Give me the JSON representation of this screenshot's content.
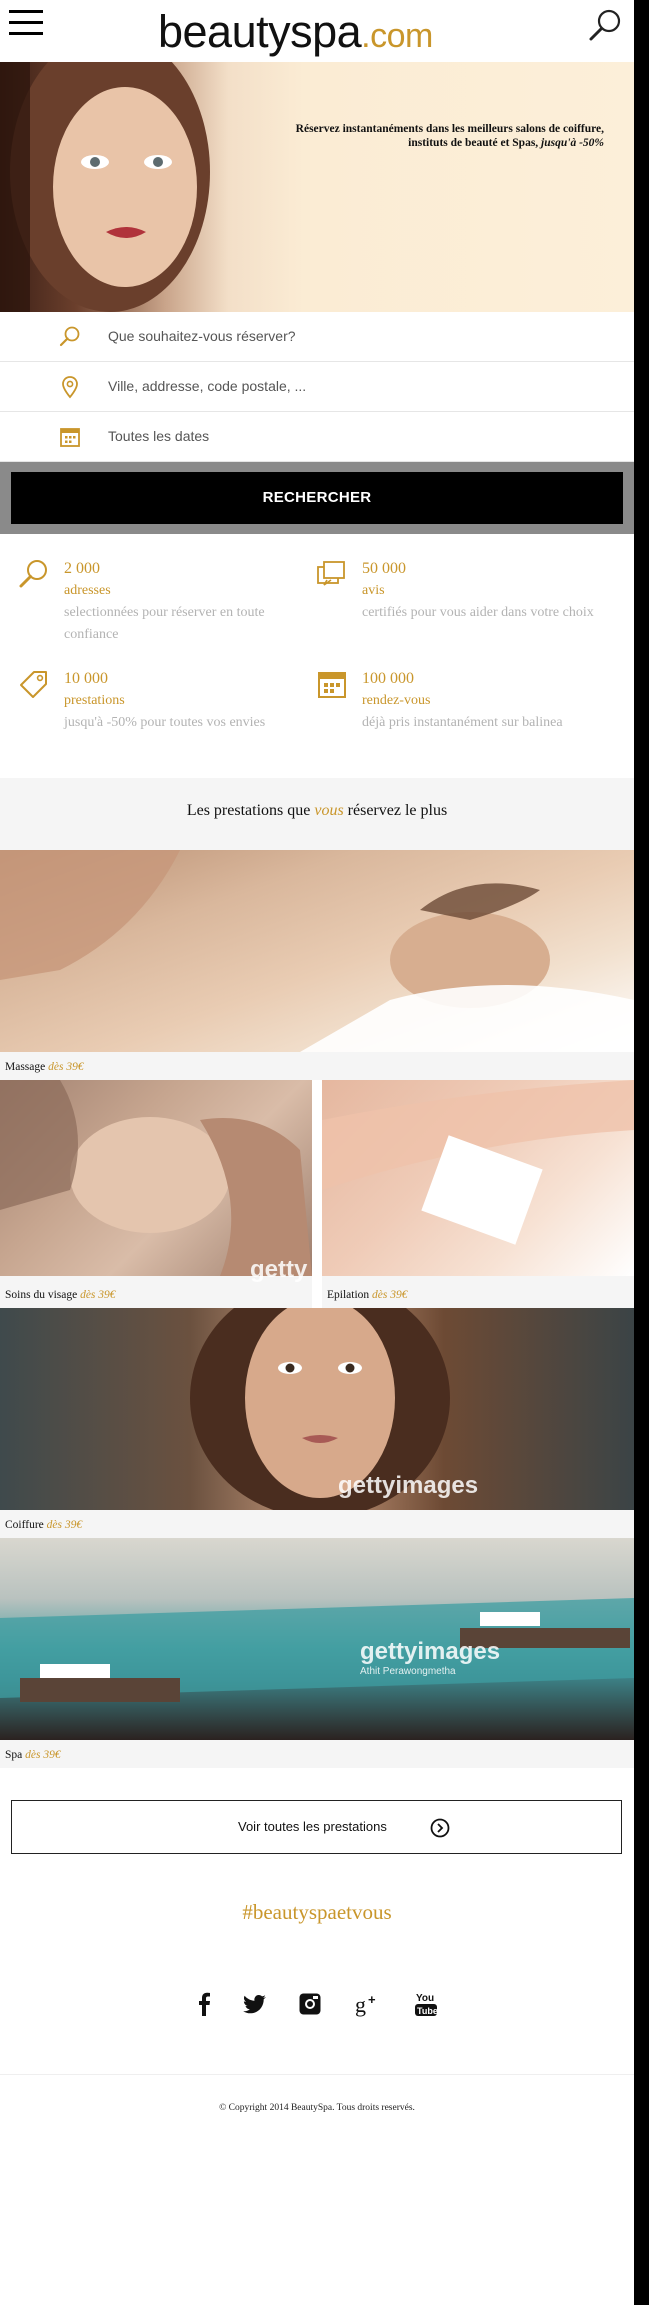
{
  "header": {
    "logo_main": "beautyspa",
    "logo_domain": ".com"
  },
  "hero": {
    "line1": "Réservez instantanéments dans les meilleurs salons de coiffure,",
    "line2_prefix": "instituts de beauté et Spas,",
    "line2_em": "jusqu'à -50%"
  },
  "search": {
    "what_placeholder": "Que souhaitez-vous réserver?",
    "where_placeholder": "Ville, addresse, code postale, ...",
    "when_placeholder": "Toutes les dates",
    "button_label": "RECHERCHER"
  },
  "stats": [
    {
      "number": "2 000",
      "label": "adresses",
      "description": "selectionnées pour réserver en toute confiance",
      "icon": "search-icon"
    },
    {
      "number": "50 000",
      "label": "avis",
      "description": "certifiés pour vous aider dans votre choix",
      "icon": "reviews-icon"
    },
    {
      "number": "10 000",
      "label": "prestations",
      "description": "jusqu'à -50% pour toutes vos envies",
      "icon": "price-tag-icon"
    },
    {
      "number": "100 000",
      "label": "rendez-vous",
      "description": "déjà pris instantanément sur balinea",
      "icon": "calendar-icon"
    }
  ],
  "prestations": {
    "title_prefix": "Les prestations que",
    "title_em": "vous",
    "title_suffix": "réservez le plus",
    "items": [
      {
        "name": "Massage",
        "price": "dès 39€"
      },
      {
        "name": "Soins du visage",
        "price": "dès 39€"
      },
      {
        "name": "Epilation",
        "price": "dès 39€"
      },
      {
        "name": "Coiffure",
        "price": "dès 39€"
      },
      {
        "name": "Spa",
        "price": "dès 39€"
      }
    ],
    "watermark": "gettyimages",
    "watermark_credit": "Athit Perawongmetha",
    "watermark_partial": "getty",
    "see_all_label": "Voir toutes les prestations"
  },
  "hashtag": "#beautyspaetvous",
  "social": [
    "facebook-icon",
    "twitter-icon",
    "instagram-icon",
    "google-plus-icon",
    "youtube-icon"
  ],
  "footer": {
    "copyright": "© Copyright 2014 BeautySpa. Tous droits reservés."
  },
  "colors": {
    "accent": "#c9962b",
    "button": "#000000",
    "muted_text": "#b3b3b3"
  }
}
